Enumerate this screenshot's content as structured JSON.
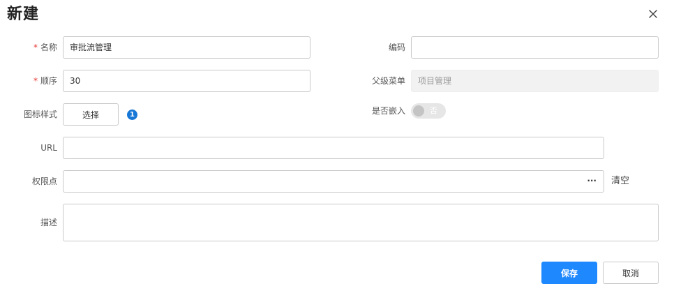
{
  "dialog": {
    "title": "新建",
    "close_icon": "close-icon"
  },
  "form": {
    "required_mark": "*",
    "name": {
      "label": "名称",
      "value": "审批流管理",
      "required": true
    },
    "code": {
      "label": "编码",
      "value": ""
    },
    "order": {
      "label": "顺序",
      "value": "30",
      "required": true
    },
    "parent_menu": {
      "label": "父级菜单",
      "value": "项目管理",
      "disabled": true
    },
    "icon_style": {
      "label": "图标样式",
      "button": "选择",
      "badge": "1",
      "badge_color": "#1677d6"
    },
    "embed": {
      "label": "是否嵌入",
      "toggle_text": "否",
      "checked": false,
      "disabled": true
    },
    "url": {
      "label": "URL",
      "value": ""
    },
    "permission": {
      "label": "权限点",
      "value": "",
      "more": "···",
      "clear": "清空"
    },
    "description": {
      "label": "描述",
      "value": ""
    }
  },
  "footer": {
    "save": "保存",
    "cancel": "取消",
    "primary_color": "#1e88ff"
  }
}
